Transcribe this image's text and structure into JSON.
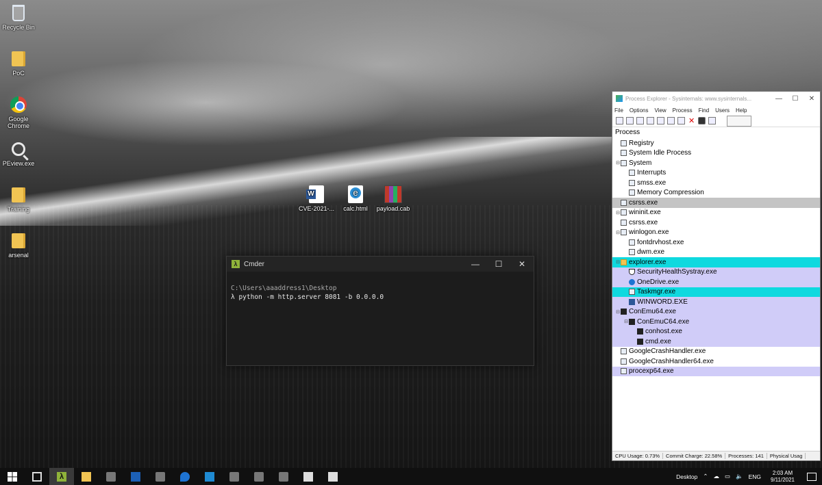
{
  "desktop": {
    "icons": [
      {
        "label": "Recycle Bin",
        "icon": "recycle-bin-icon"
      },
      {
        "label": "PoC",
        "icon": "folder-icon"
      },
      {
        "label": "Google Chrome",
        "icon": "chrome-icon"
      },
      {
        "label": "PEview.exe",
        "icon": "magnifier-icon"
      },
      {
        "label": "Training",
        "icon": "folder-icon"
      },
      {
        "label": "arsenal",
        "icon": "folder-icon"
      },
      {
        "label": "CVE-2021-...",
        "icon": "word-document-icon"
      },
      {
        "label": "calc.html",
        "icon": "html-file-icon"
      },
      {
        "label": "payload.cab",
        "icon": "cab-archive-icon"
      }
    ]
  },
  "cmder": {
    "title": "Cmder",
    "controls": {
      "minimize": "—",
      "maximize": "☐",
      "close": "✕"
    },
    "prompt_path": "C:\\Users\\aaaddress1\\Desktop",
    "command": "λ python -m http.server 8081 -b 0.0.0.0"
  },
  "procexp": {
    "title": "Process Explorer - Sysinternals: www.sysinternals...",
    "menu": [
      "File",
      "Options",
      "View",
      "Process",
      "Find",
      "Users",
      "Help"
    ],
    "column_header": "Process",
    "processes": [
      {
        "name": "Registry",
        "depth": 0,
        "highlight": "none",
        "icon": "process-icon"
      },
      {
        "name": "System Idle Process",
        "depth": 0,
        "highlight": "none",
        "icon": "process-icon"
      },
      {
        "name": "System",
        "depth": 0,
        "highlight": "none",
        "icon": "process-icon",
        "expanded": true
      },
      {
        "name": "Interrupts",
        "depth": 1,
        "highlight": "none",
        "icon": "process-icon"
      },
      {
        "name": "smss.exe",
        "depth": 1,
        "highlight": "none",
        "icon": "process-icon"
      },
      {
        "name": "Memory Compression",
        "depth": 1,
        "highlight": "none",
        "icon": "process-icon"
      },
      {
        "name": "csrss.exe",
        "depth": 0,
        "highlight": "gray",
        "icon": "process-icon"
      },
      {
        "name": "wininit.exe",
        "depth": 0,
        "highlight": "none",
        "icon": "process-icon",
        "expanded": true
      },
      {
        "name": "csrss.exe",
        "depth": 0,
        "highlight": "none",
        "icon": "process-icon"
      },
      {
        "name": "winlogon.exe",
        "depth": 0,
        "highlight": "none",
        "icon": "process-icon",
        "expanded": true
      },
      {
        "name": "fontdrvhost.exe",
        "depth": 1,
        "highlight": "none",
        "icon": "process-icon"
      },
      {
        "name": "dwm.exe",
        "depth": 1,
        "highlight": "none",
        "icon": "process-icon"
      },
      {
        "name": "explorer.exe",
        "depth": 0,
        "highlight": "cyan",
        "icon": "folder-icon",
        "expanded": true
      },
      {
        "name": "SecurityHealthSystray.exe",
        "depth": 1,
        "highlight": "lavender",
        "icon": "shield-icon"
      },
      {
        "name": "OneDrive.exe",
        "depth": 1,
        "highlight": "lavender",
        "icon": "onedrive-icon"
      },
      {
        "name": "Taskmgr.exe",
        "depth": 1,
        "highlight": "cyan",
        "icon": "taskmgr-icon"
      },
      {
        "name": "WINWORD.EXE",
        "depth": 1,
        "highlight": "lavender",
        "icon": "word-icon"
      },
      {
        "name": "ConEmu64.exe",
        "depth": 0,
        "highlight": "lavender",
        "icon": "console-icon",
        "expanded": true
      },
      {
        "name": "ConEmuC64.exe",
        "depth": 1,
        "highlight": "lavender",
        "icon": "console-icon",
        "expanded": true
      },
      {
        "name": "conhost.exe",
        "depth": 2,
        "highlight": "lavender",
        "icon": "console-icon"
      },
      {
        "name": "cmd.exe",
        "depth": 2,
        "highlight": "lavender",
        "icon": "console-icon"
      },
      {
        "name": "GoogleCrashHandler.exe",
        "depth": 0,
        "highlight": "none",
        "icon": "process-icon"
      },
      {
        "name": "GoogleCrashHandler64.exe",
        "depth": 0,
        "highlight": "none",
        "icon": "process-icon"
      },
      {
        "name": "procexp64.exe",
        "depth": 0,
        "highlight": "lavender",
        "icon": "procexp-icon"
      }
    ],
    "status": {
      "cpu": "CPU Usage: 0.73%",
      "commit": "Commit Charge: 22.58%",
      "processes": "Processes: 141",
      "physical": "Physical Usag"
    }
  },
  "taskbar": {
    "desktop_label": "Desktop",
    "language": "ENG",
    "time": "2:03 AM",
    "date": "9/11/2021"
  },
  "colors": {
    "highlight_gray": "#c4c4c4",
    "highlight_cyan": "#0fd9df",
    "highlight_lavender": "#d0ccf8",
    "cmder_accent": "#8fb33a"
  }
}
